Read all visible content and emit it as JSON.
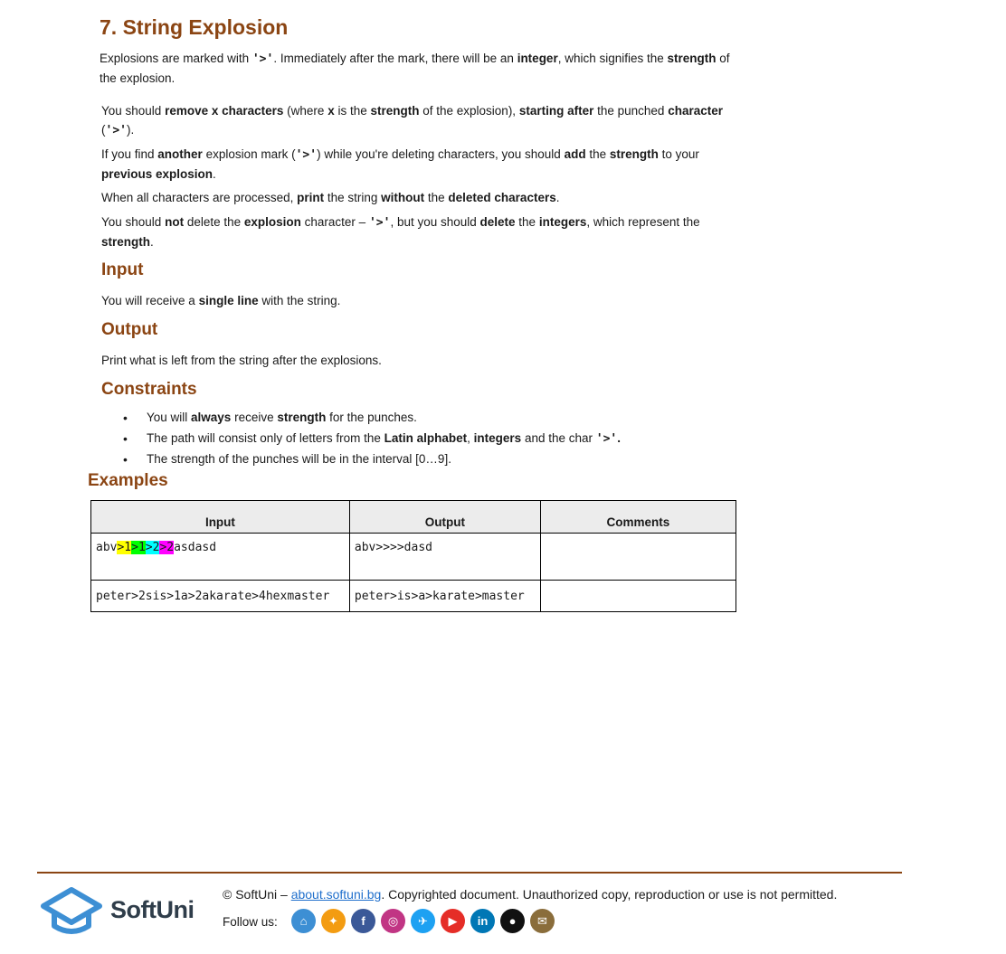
{
  "title": "7. String Explosion",
  "intro": {
    "t1": "Explosions are marked with ",
    "mark": "'>'",
    "t2": ". Immediately after the mark, there will be an ",
    "b1": "integer",
    "t3": ", which signifies the ",
    "b2": "strength",
    "t4": " of the explosion."
  },
  "p_remove": {
    "t1": "You should ",
    "b1": "remove x characters",
    "t2": " (where ",
    "b2": "x",
    "t3": " is the ",
    "b3": "strength",
    "t4": " of the explosion), ",
    "b4": "starting after",
    "t5": " the punched ",
    "b5": "character",
    "t6": " (",
    "mark": "'>'",
    "t7": ")."
  },
  "p_another": {
    "t1": "If you find ",
    "b1": "another",
    "t2": " explosion mark (",
    "mark": "'>'",
    "t3": ") while you're deleting characters, you should ",
    "b2": "add",
    "t4": " the ",
    "b3": "strength",
    "t5": " to your ",
    "b4": "previous explosion",
    "t6": "."
  },
  "p_print": {
    "t1": "When all characters are processed, ",
    "b1": "print",
    "t2": " the string ",
    "b2": "without",
    "t3": " the ",
    "b3": "deleted characters",
    "t4": "."
  },
  "p_notdelete": {
    "t1": "You should ",
    "b1": "not",
    "t2": " delete the ",
    "b2": "explosion",
    "t3": " character – ",
    "mark": "'>'",
    "t4": ", but you should ",
    "b3": "delete",
    "t5": " the ",
    "b4": "integers",
    "t6": ", which represent the ",
    "b5": "strength",
    "t7": "."
  },
  "input_section": {
    "heading": "Input",
    "t1": "You will receive a ",
    "b1": "single line",
    "t2": " with the string."
  },
  "output_section": {
    "heading": "Output",
    "text": "Print what is left from the string after the explosions."
  },
  "constraints": {
    "heading": "Constraints",
    "items": [
      {
        "t1": "You will ",
        "b1": "always",
        "t2": " receive ",
        "b2": "strength",
        "t3": " for the punches."
      },
      {
        "t1": "The path will consist only of letters from the ",
        "b1": "Latin alphabet",
        "t2": ", ",
        "b2": "integers",
        "t3": " and the char ",
        "mark": "'>'",
        "t4": "."
      },
      {
        "t1": "The strength of the punches will be in the interval [0…9]."
      }
    ]
  },
  "examples": {
    "heading": "Examples",
    "headers": [
      "Input",
      "Output",
      "Comments"
    ],
    "row1": {
      "input_prefix": "abv",
      "segments": [
        {
          "text": ">1",
          "color": "#ffff00"
        },
        {
          "text": ">1",
          "color": "#00ff00"
        },
        {
          "text": ">2",
          "color": "#00ffff"
        },
        {
          "text": ">2",
          "color": "#ff00ff"
        }
      ],
      "input_suffix": "asdasd",
      "output": "abv>>>>dasd",
      "comments": ""
    },
    "row2": {
      "input": "peter>2sis>1a>2akarate>4hexmaster",
      "output": "peter>is>a>karate>master",
      "comments": ""
    }
  },
  "footer": {
    "brand": "SoftUni",
    "copy_prefix": "© SoftUni – ",
    "link": "about.softuni.bg",
    "copy_suffix": ". Copyrighted document. Unauthorized copy, reproduction or use is not permitted.",
    "follow": "Follow us:",
    "accent": "#8b4513",
    "socials": [
      {
        "name": "softuni-icon",
        "color": "#3d8fd4",
        "glyph": "⌂"
      },
      {
        "name": "softuni-creative-icon",
        "color": "#f39c12",
        "glyph": "✦"
      },
      {
        "name": "facebook-icon",
        "color": "#3b5998",
        "glyph": "f"
      },
      {
        "name": "instagram-icon",
        "color": "#c13584",
        "glyph": "◎"
      },
      {
        "name": "twitter-icon",
        "color": "#1da1f2",
        "glyph": "✈"
      },
      {
        "name": "youtube-icon",
        "color": "#e52d27",
        "glyph": "▶"
      },
      {
        "name": "linkedin-icon",
        "color": "#0077b5",
        "glyph": "in"
      },
      {
        "name": "github-icon",
        "color": "#111111",
        "glyph": "●"
      },
      {
        "name": "forum-icon",
        "color": "#8a6d3b",
        "glyph": "✉"
      }
    ]
  }
}
